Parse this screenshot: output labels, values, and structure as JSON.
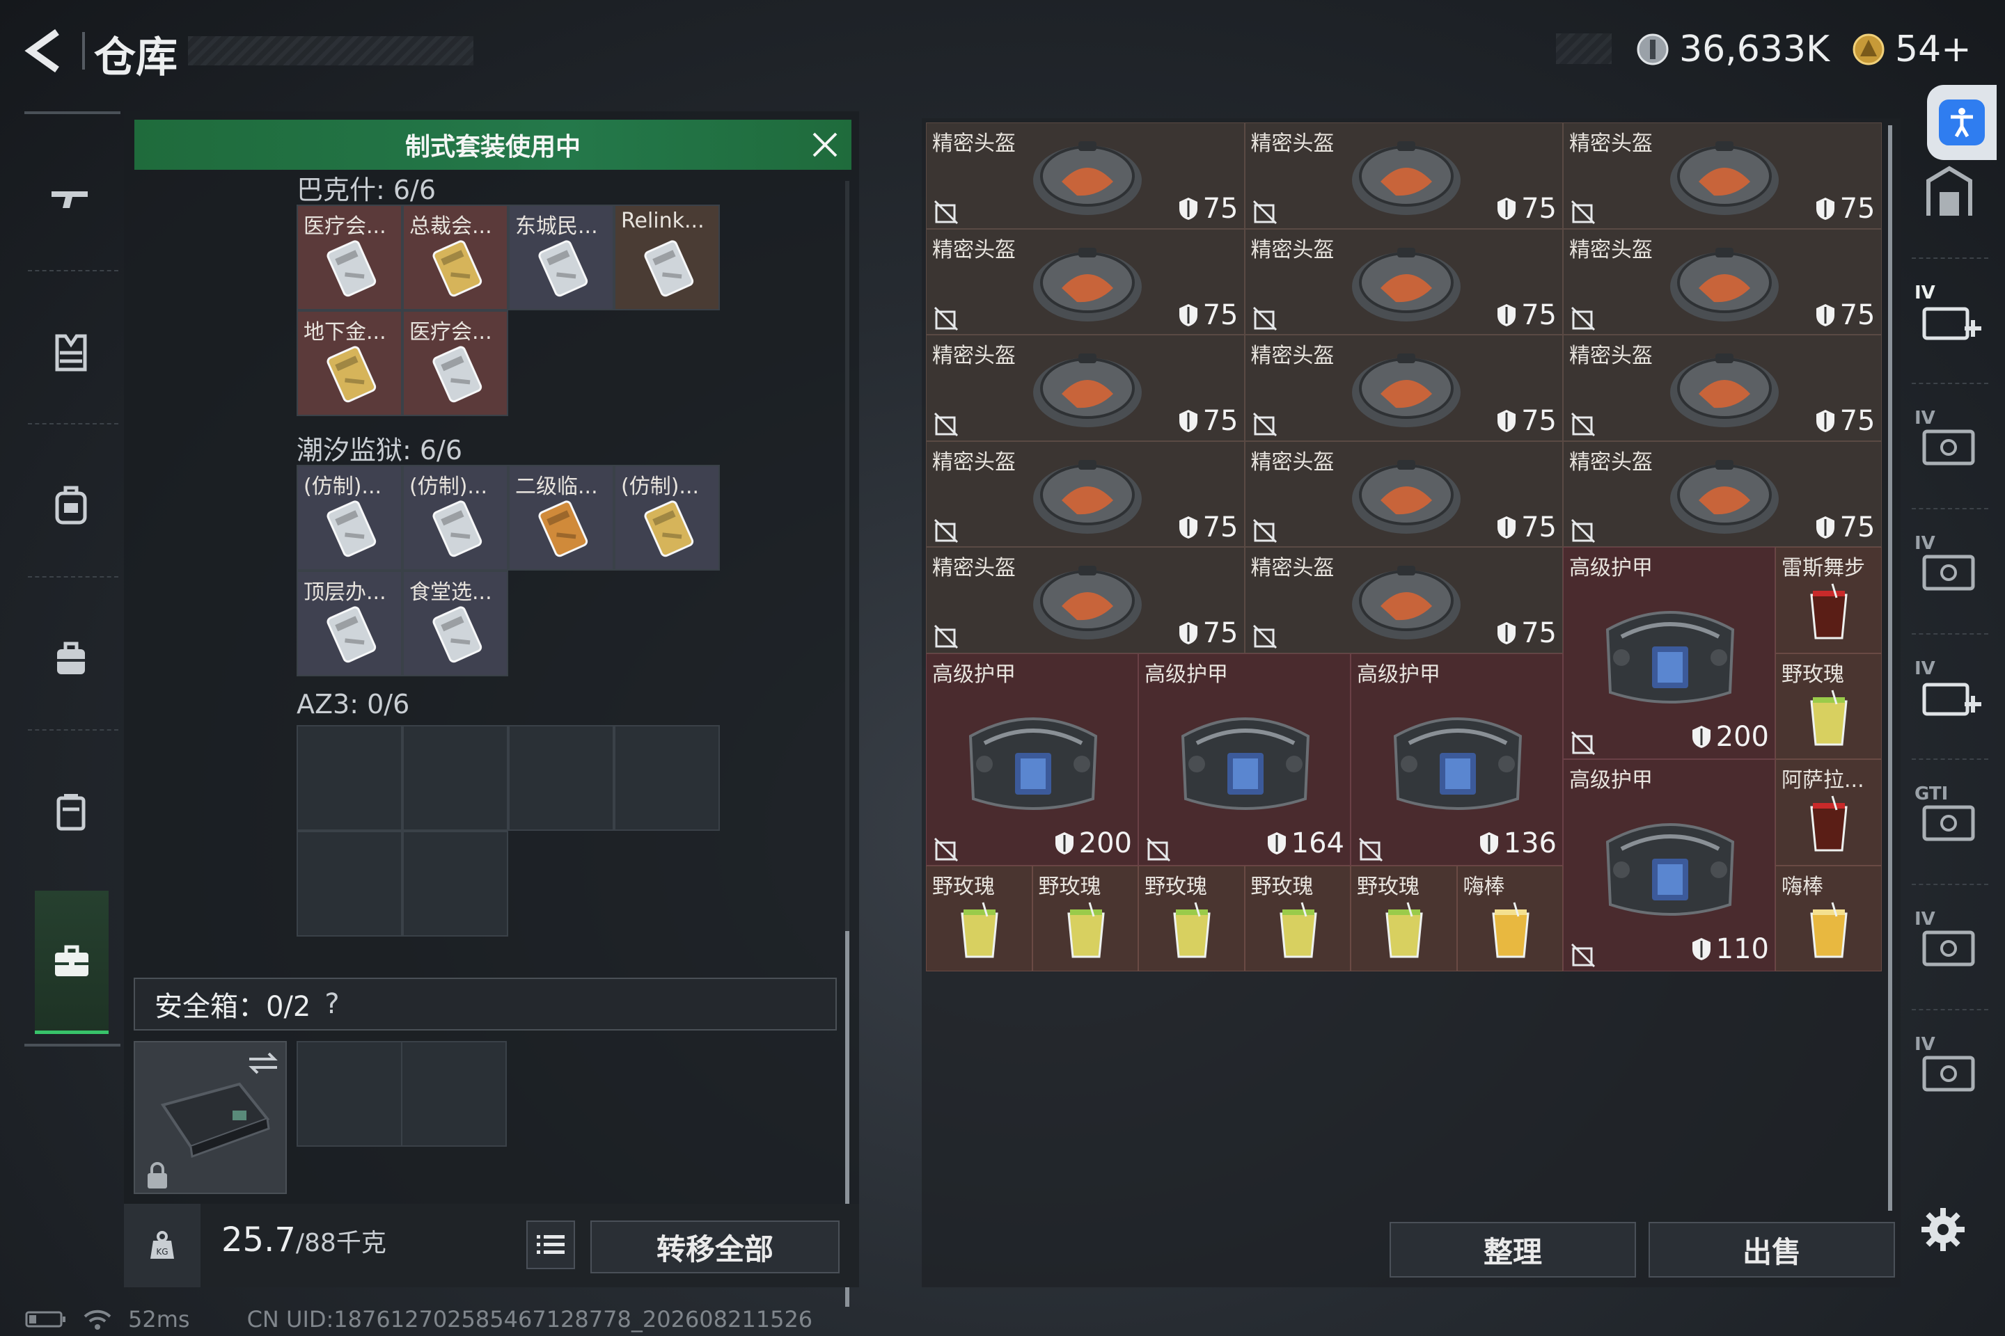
{
  "header": {
    "title": "仓库",
    "currency_amount": "36,633K",
    "tickets": "54+"
  },
  "left_rail": {
    "items": [
      {
        "name": "weapon-icon"
      },
      {
        "name": "armor-vest-icon"
      },
      {
        "name": "backpack-icon"
      },
      {
        "name": "bag-icon"
      },
      {
        "name": "container-icon"
      },
      {
        "name": "briefcase-icon"
      }
    ]
  },
  "loadout": {
    "banner": "制式套装使用中",
    "groups": [
      {
        "title": "巴克什: 6/6",
        "cards": [
          {
            "label": "医疗会...",
            "color": "#5b3a3a",
            "tint": "silver"
          },
          {
            "label": "总裁会...",
            "color": "#5b3a3a",
            "tint": "gold"
          },
          {
            "label": "东城民...",
            "color": "#3f4150",
            "tint": "silver"
          },
          {
            "label": "Relink...",
            "color": "#4a3c34",
            "tint": "silver"
          },
          {
            "label": "地下金...",
            "color": "#5b3a3a",
            "tint": "gold"
          },
          {
            "label": "医疗会...",
            "color": "#5b3a3a",
            "tint": "silver"
          }
        ]
      },
      {
        "title": "潮汐监狱: 6/6",
        "cards": [
          {
            "label": "(仿制)...",
            "color": "#3f4150",
            "tint": "silver"
          },
          {
            "label": "(仿制)...",
            "color": "#3f4150",
            "tint": "silver"
          },
          {
            "label": "二级临...",
            "color": "#3f4150",
            "tint": "orange"
          },
          {
            "label": "(仿制)...",
            "color": "#3f4150",
            "tint": "gold"
          },
          {
            "label": "顶层办...",
            "color": "#3f4150",
            "tint": "silver"
          },
          {
            "label": "食堂选...",
            "color": "#3f4150",
            "tint": "silver"
          }
        ]
      },
      {
        "title": "AZ3: 0/6"
      }
    ],
    "safebox": "安全箱：0/2",
    "safebox_help": "?",
    "weight_current": "25.7",
    "weight_max": "/88千克",
    "transfer_all": "转移全部"
  },
  "storage": {
    "helmets": [
      {
        "label": "精密头盔",
        "value": "75"
      },
      {
        "label": "精密头盔",
        "value": "75"
      },
      {
        "label": "精密头盔",
        "value": "75"
      },
      {
        "label": "精密头盔",
        "value": "75"
      },
      {
        "label": "精密头盔",
        "value": "75"
      },
      {
        "label": "精密头盔",
        "value": "75"
      },
      {
        "label": "精密头盔",
        "value": "75"
      },
      {
        "label": "精密头盔",
        "value": "75"
      },
      {
        "label": "精密头盔",
        "value": "75"
      },
      {
        "label": "精密头盔",
        "value": "75"
      },
      {
        "label": "精密头盔",
        "value": "75"
      },
      {
        "label": "精密头盔",
        "value": "75"
      },
      {
        "label": "精密头盔",
        "value": "75"
      },
      {
        "label": "精密头盔",
        "value": "75"
      }
    ],
    "armors": [
      {
        "label": "高级护甲",
        "value": "200"
      },
      {
        "label": "高级护甲",
        "value": "200"
      },
      {
        "label": "高级护甲",
        "value": "164"
      },
      {
        "label": "高级护甲",
        "value": "136"
      },
      {
        "label": "高级护甲",
        "value": "110"
      }
    ],
    "drinks": [
      {
        "label": "雷斯舞步",
        "kind": "cola"
      },
      {
        "label": "野玫瑰",
        "kind": "lemon"
      },
      {
        "label": "阿萨拉...",
        "kind": "cola"
      },
      {
        "label": "嗨棒",
        "kind": "highball"
      },
      {
        "label": "野玫瑰",
        "kind": "lemon"
      },
      {
        "label": "野玫瑰",
        "kind": "lemon"
      },
      {
        "label": "野玫瑰",
        "kind": "lemon"
      },
      {
        "label": "野玫瑰",
        "kind": "lemon"
      },
      {
        "label": "野玫瑰",
        "kind": "lemon"
      },
      {
        "label": "嗨棒",
        "kind": "highball"
      }
    ],
    "organize": "整理",
    "sell": "出售"
  },
  "right_rail": {
    "items": [
      {
        "name": "storage-tab-all-icon"
      },
      {
        "name": "storage-tab-1-icon",
        "badge": "IV"
      },
      {
        "name": "storage-tab-2-icon",
        "badge": "IV"
      },
      {
        "name": "storage-tab-3-icon",
        "badge": "IV"
      },
      {
        "name": "storage-tab-4-icon",
        "badge": "IV"
      },
      {
        "name": "storage-tab-5-icon",
        "badge": "GTI"
      },
      {
        "name": "storage-tab-6-icon",
        "badge": "IV"
      },
      {
        "name": "storage-tab-7-icon",
        "badge": "IV"
      }
    ]
  },
  "footer": {
    "ping": "52ms",
    "uid": "CN UID:18761270258546712877​8_202608211526"
  },
  "colors": {
    "banner_green": "#1f6b3c",
    "helmet_cell": "#3b3532",
    "armor_cell": "#4a2b2e",
    "drink_cell": "#4a3530"
  }
}
